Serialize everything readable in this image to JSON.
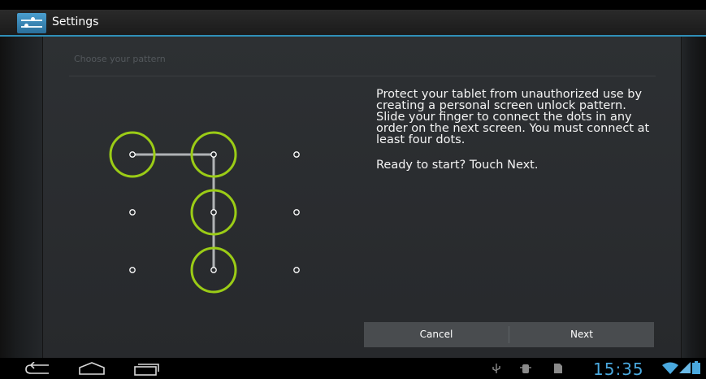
{
  "actionbar": {
    "title": "Settings",
    "app_icon": "settings-sliders-icon"
  },
  "screen": {
    "title": "Choose your pattern",
    "description": "Protect your tablet from unauthorized use by creating a personal screen unlock pattern. Slide your finger to connect the dots in any order on the next screen. You must connect at least four dots.",
    "prompt": "Ready to start? Touch Next."
  },
  "pattern": {
    "grid": "3x3",
    "highlight_color": "#9bcc16",
    "selected_dots": [
      1,
      2,
      5,
      8
    ],
    "sequence": [
      1,
      2,
      5,
      8
    ]
  },
  "buttons": {
    "cancel_label": "Cancel",
    "next_label": "Next"
  },
  "navbar": {
    "back_icon": "back-icon",
    "home_icon": "home-icon",
    "recents_icon": "recent-apps-icon"
  },
  "status": {
    "clock": "15:35",
    "icons": [
      "usb-icon",
      "debug-icon",
      "sd-card-icon",
      "wifi-icon",
      "signal-icon",
      "battery-icon"
    ],
    "accent_color": "#4aa9df"
  }
}
